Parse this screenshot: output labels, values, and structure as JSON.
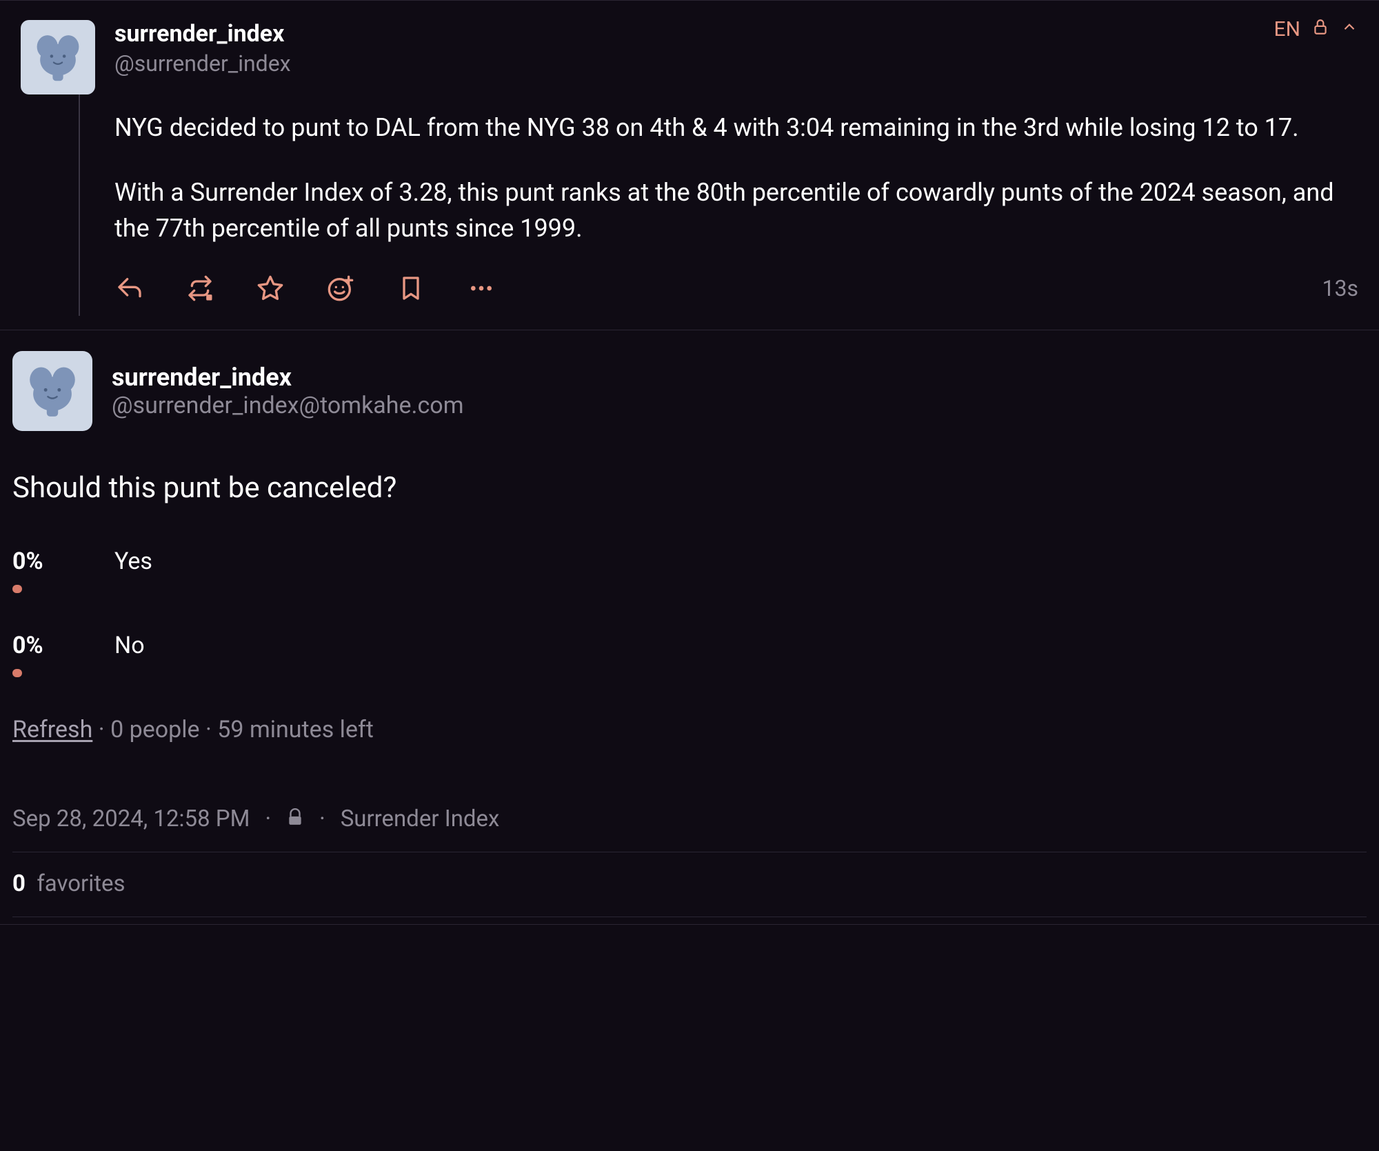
{
  "top_bar": {
    "lang": "EN"
  },
  "parent_post": {
    "display_name": "surrender_index",
    "handle": "@surrender_index",
    "body_p1": "NYG decided to punt to DAL from the NYG 38 on 4th & 4 with 3:04 remaining in the 3rd while losing 12 to 17.",
    "body_p2": "With a Surrender Index of 3.28, this punt ranks at the 80th percentile of cowardly punts of the 2024 season, and the 77th percentile of all punts since 1999.",
    "relative_time": "13s"
  },
  "detail_post": {
    "display_name": "surrender_index",
    "handle": "@surrender_index@tomkahe.com",
    "poll_question": "Should this punt be canceled?",
    "poll_options": [
      {
        "percent": "0%",
        "label": "Yes"
      },
      {
        "percent": "0%",
        "label": "No"
      }
    ],
    "poll_refresh": "Refresh",
    "poll_people": "0 people",
    "poll_time_left": "59 minutes left",
    "timestamp": "Sep 28, 2024, 12:58 PM",
    "app_name": "Surrender Index",
    "favorites_count": "0",
    "favorites_label": "favorites"
  }
}
